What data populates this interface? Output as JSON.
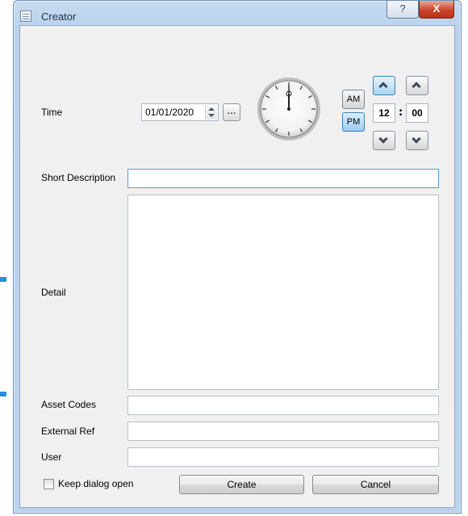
{
  "window": {
    "title": "Creator",
    "help_glyph": "?",
    "close_glyph": "X"
  },
  "time": {
    "label": "Time",
    "date_value": "01/01/2020",
    "date_picker_label": "...",
    "am_label": "AM",
    "pm_label": "PM",
    "selected_period": "PM",
    "hour": "12",
    "minute": "00",
    "separator": ":"
  },
  "form": {
    "short_description_label": "Short Description",
    "short_description_value": "",
    "detail_label": "Detail",
    "detail_value": "",
    "asset_codes_label": "Asset Codes",
    "asset_codes_value": "",
    "external_ref_label": "External Ref",
    "external_ref_value": "",
    "user_label": "User",
    "user_value": ""
  },
  "footer": {
    "keep_open_label": "Keep dialog open",
    "keep_open_checked": false,
    "create_label": "Create",
    "cancel_label": "Cancel"
  },
  "icons": [
    "window-icon",
    "help-icon",
    "close-icon",
    "calendar-spin-icon",
    "clock-icon",
    "chevron-up-icon",
    "chevron-down-icon"
  ],
  "colors": {
    "accent": "#3c7fb1",
    "selected_pm": "#9ccdf2",
    "close_button": "#c9452d"
  }
}
